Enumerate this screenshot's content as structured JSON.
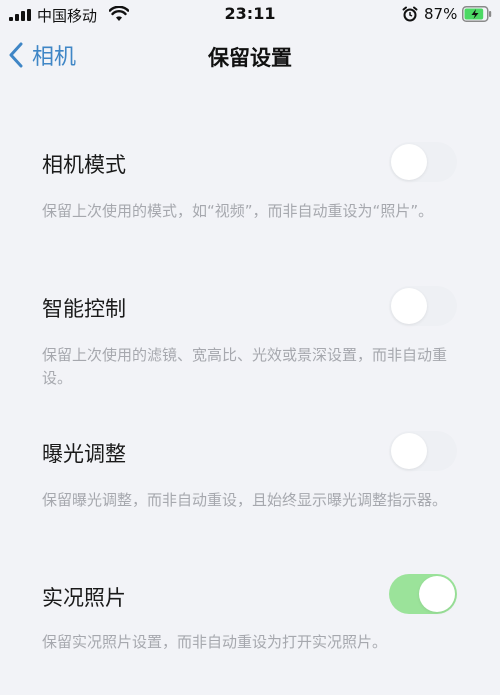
{
  "status_bar": {
    "carrier": "中国移动",
    "time": "23:11",
    "battery_percent": "87%",
    "battery_level": 0.87,
    "charging": true,
    "icons": [
      "signal-icon",
      "wifi-icon",
      "alarm-icon",
      "battery-icon"
    ]
  },
  "nav": {
    "back_label": "相机",
    "title": "保留设置",
    "back_icon": "chevron-left-icon",
    "accent_color": "#3f86c6"
  },
  "settings": [
    {
      "label": "相机模式",
      "description": "保留上次使用的模式，如“视频”，而非自动重设为“照片”。",
      "on": false
    },
    {
      "label": "智能控制",
      "description": "保留上次使用的滤镜、宽高比、光效或景深设置，而非自动重设。",
      "on": false
    },
    {
      "label": "曝光调整",
      "description": "保留曝光调整，而非自动重设，且始终显示曝光调整指示器。",
      "on": false
    },
    {
      "label": "实况照片",
      "description": "保留实况照片设置，而非自动重设为打开实况照片。",
      "on": true
    }
  ],
  "colors": {
    "toggle_on": "#9be39a",
    "toggle_off": "#eef0f4",
    "background": "#f2f3f7",
    "description_text": "#a6a8ae"
  }
}
